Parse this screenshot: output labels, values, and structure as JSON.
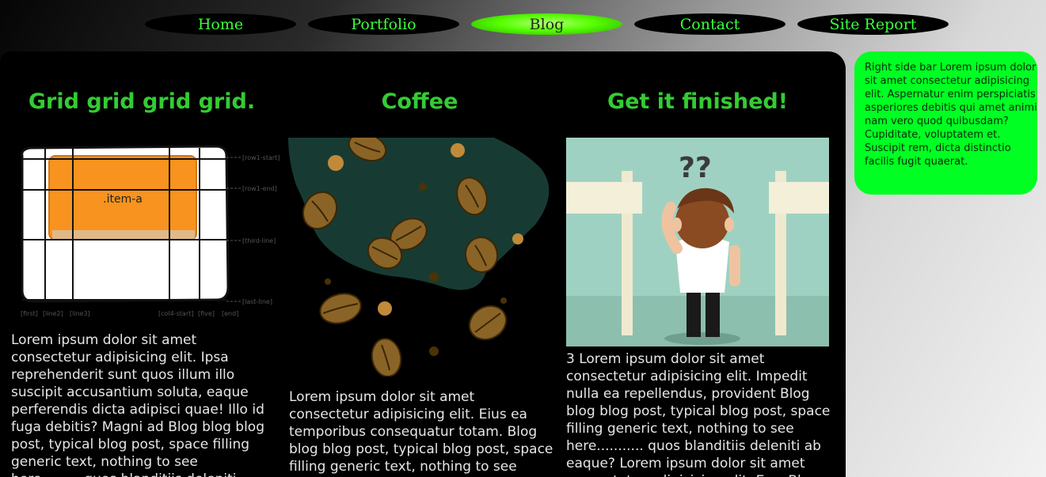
{
  "nav": {
    "items": [
      {
        "label": "Home",
        "active": false
      },
      {
        "label": "Portfolio",
        "active": false
      },
      {
        "label": "Blog",
        "active": true
      },
      {
        "label": "Contact",
        "active": false
      },
      {
        "label": "Site Report",
        "active": false
      }
    ]
  },
  "posts": [
    {
      "title": "Grid grid grid grid.",
      "image": {
        "item_label": ".item-a",
        "line_labels_right": [
          "[row1-start]",
          "[row1-end]",
          "[third-line]",
          "[last-line]"
        ],
        "line_labels_bottom": [
          "[first]",
          "[line2]",
          "[line3]",
          "[col4-start]",
          "[five]",
          "[end]"
        ]
      },
      "body": "Lorem ipsum dolor sit amet consectetur adipisicing elit. Ipsa reprehenderit sunt quos illum illo suscipit accusantium soluta, eaque perferendis dicta adipisci quae! Illo id fuga debitis? Magni ad Blog blog blog post, typical blog post, space filling generic text, nothing to see here..........quos blanditiis deleniti"
    },
    {
      "title": "Coffee",
      "image": {
        "icon": "coffee-beans-icon"
      },
      "body": "Lorem ipsum dolor sit amet consectetur adipisicing elit. Eius ea temporibus consequatur totam. Blog blog blog post, typical blog post, space filling generic text, nothing to see here..."
    },
    {
      "title": "Get it finished!",
      "image": {
        "icon": "confused-person-icon",
        "question_marks": "??"
      },
      "body": "3 Lorem ipsum dolor sit amet consectetur adipisicing elit. Impedit nulla ea repellendus, provident Blog blog blog post, typical blog post, space filling generic text, nothing to see here........... quos blanditiis deleniti ab eaque? Lorem ipsum dolor sit amet consectetur adipisicing elit. Eos. Blog"
    }
  ],
  "sidebar": {
    "text": "Right side bar Lorem ipsum dolor sit amet consectetur adipisicing elit. Aspernatur enim perspiciatis asperiores debitis qui amet animi nam vero quod quibusdam? Cupiditate, voluptatem et. Suscipit rem, dicta distinctio facilis fugit quaerat."
  },
  "colors": {
    "nav_text": "#3cff3c",
    "heading": "#33cc33",
    "sidebar_bg": "#00ff22",
    "accent_orange": "#f7931e"
  }
}
